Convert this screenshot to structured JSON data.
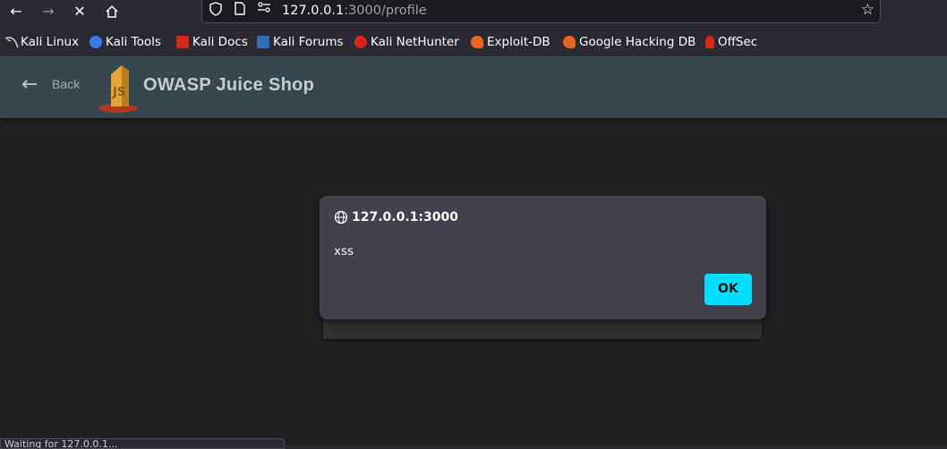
{
  "browser": {
    "url_host": "127.0.0.1",
    "url_path": ":3000/profile",
    "icons": {
      "back": "arrow-left-icon",
      "forward": "arrow-right-icon",
      "stop": "stop-loading-icon",
      "home": "home-icon",
      "shield": "tracking-protection-icon",
      "page": "page-info-icon",
      "permissions": "permissions-icon",
      "bookmark": "star-icon"
    }
  },
  "bookmarks": [
    {
      "label": "Kali Linux",
      "color": "#cfcfcf"
    },
    {
      "label": "Kali Tools",
      "color": "#3b78e7"
    },
    {
      "label": "Kali Docs",
      "color": "#d6271d"
    },
    {
      "label": "Kali Forums",
      "color": "#2f6fb8"
    },
    {
      "label": "Kali NetHunter",
      "color": "#d6271d"
    },
    {
      "label": "Exploit-DB",
      "color": "#e8661f"
    },
    {
      "label": "Google Hacking DB",
      "color": "#e8661f"
    },
    {
      "label": "OffSec",
      "color": "#d6271d"
    }
  ],
  "app": {
    "back_label": "Back",
    "title": "OWASP Juice Shop",
    "logo_color": "#e3a43a"
  },
  "alert": {
    "origin": "127.0.0.1:3000",
    "message": "xss",
    "ok_label": "OK",
    "button_color": "#00ddff"
  },
  "status_bar": {
    "text": "Waiting for 127.0.0.1..."
  }
}
